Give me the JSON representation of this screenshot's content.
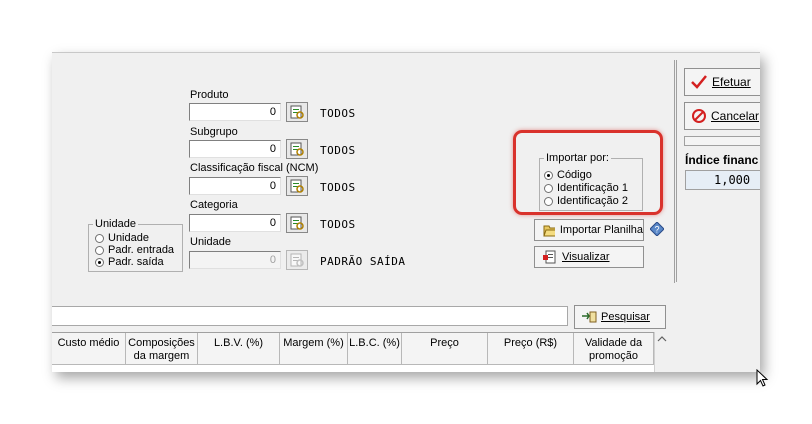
{
  "filters": {
    "produto": {
      "label": "Produto",
      "value": "0",
      "desc": "TODOS"
    },
    "subgrupo": {
      "label": "Subgrupo",
      "value": "0",
      "desc": "TODOS"
    },
    "classificacao": {
      "label": "Classificação fiscal (NCM)",
      "value": "0",
      "desc": "TODOS"
    },
    "categoria": {
      "label": "Categoria",
      "value": "0",
      "desc": "TODOS"
    },
    "unidade": {
      "label": "Unidade",
      "value": "0",
      "desc": "PADRÃO SAÍDA"
    }
  },
  "unidade_group": {
    "legend": "Unidade",
    "options": [
      {
        "label": "Unidade",
        "selected": false
      },
      {
        "label": "Padr. entrada",
        "selected": false
      },
      {
        "label": "Padr. saída",
        "selected": true
      }
    ]
  },
  "importar_group": {
    "legend": "Importar por:",
    "options": [
      {
        "label": "Código",
        "selected": true
      },
      {
        "label": "Identificação 1",
        "selected": false
      },
      {
        "label": "Identificação 2",
        "selected": false
      }
    ]
  },
  "buttons": {
    "importar_planilha": "Importar Planilha",
    "visualizar": "Visualizar",
    "pesquisar": "Pesquisar",
    "efetuar": "Efetuar",
    "cancelar": "Cancelar"
  },
  "indice": {
    "label": "Índice financ",
    "value": "1,000"
  },
  "table": {
    "columns": [
      "Custo médio",
      "Composições da margem",
      "L.B.V. (%)",
      "Margem (%)",
      "L.B.C. (%)",
      "Preço",
      "Preço (R$)",
      "Validade da promoção"
    ]
  },
  "colors": {
    "highlight": "#d9322c",
    "accent": "#d42020"
  },
  "icons": [
    "lookup-icon",
    "check-icon",
    "cancel-icon",
    "folder-open-icon",
    "document-view-icon",
    "search-pointer-icon",
    "help-diamond-icon",
    "mouse-cursor-icon"
  ]
}
